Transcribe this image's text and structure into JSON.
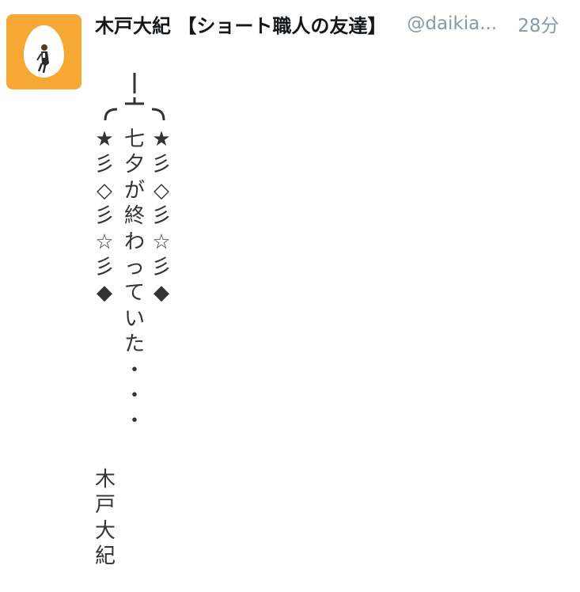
{
  "tweet": {
    "author_name": "木戸大紀 【ショート職人の友達】",
    "handle": "@daikia...",
    "time": "28分",
    "avatar_color": "#f5a834",
    "body": {
      "left_column": [
        "★",
        "彡",
        "◇",
        "彡",
        "☆",
        "彡",
        "◆"
      ],
      "middle_column": [
        "七",
        "夕",
        "が",
        "終",
        "わ",
        "っ",
        "て",
        "い",
        "た",
        "・",
        "・",
        "・"
      ],
      "right_column": [
        "★",
        "彡",
        "◇",
        "彡",
        "☆",
        "彡",
        "◆"
      ],
      "signature": [
        "木",
        "戸",
        "大",
        "紀"
      ]
    }
  }
}
